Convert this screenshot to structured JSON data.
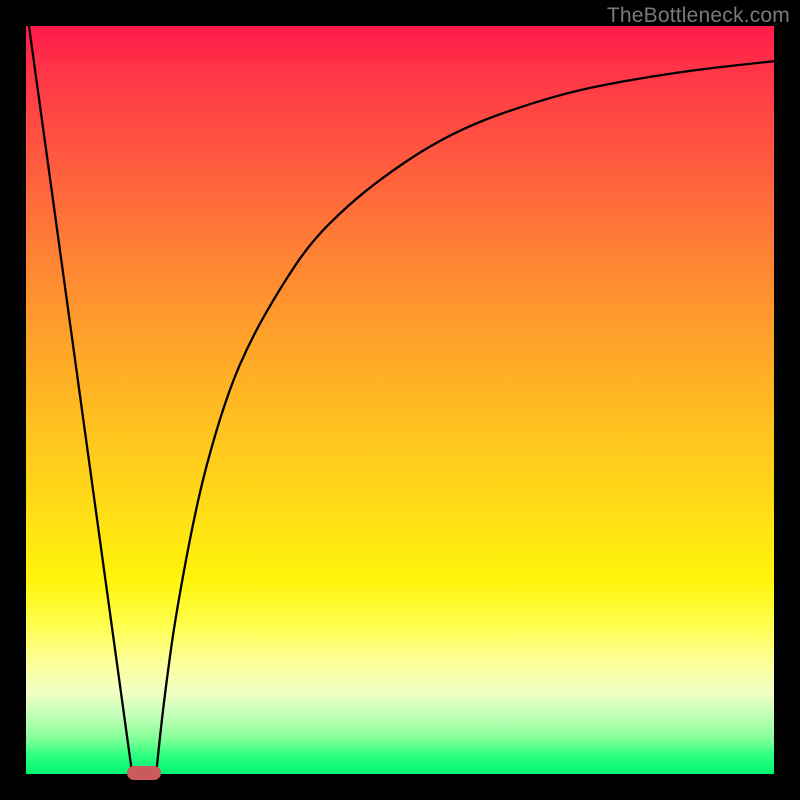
{
  "watermark": "TheBottleneck.com",
  "chart_data": {
    "type": "line",
    "title": "",
    "xlabel": "",
    "ylabel": "",
    "xlim": [
      0,
      100
    ],
    "ylim": [
      0,
      100
    ],
    "grid": false,
    "series": [
      {
        "name": "left-line",
        "x": [
          0.4,
          14.2
        ],
        "y": [
          100,
          0
        ]
      },
      {
        "name": "right-curve",
        "x": [
          17.4,
          18,
          19,
          20,
          22,
          24,
          27,
          30,
          34,
          38,
          43,
          48,
          54,
          60,
          67,
          74,
          82,
          90,
          100
        ],
        "y": [
          0,
          6,
          14,
          21,
          32,
          41,
          51,
          58,
          65,
          71,
          76,
          80,
          84,
          87,
          89.5,
          91.5,
          93,
          94.2,
          95.3
        ]
      }
    ],
    "annotation_marker": {
      "x_center": 15.8,
      "width": 4.6,
      "y": 0,
      "color": "#cc5a5a"
    },
    "gradient_colors": {
      "top": "#ff1a4a",
      "bottom": "#00f772"
    }
  }
}
